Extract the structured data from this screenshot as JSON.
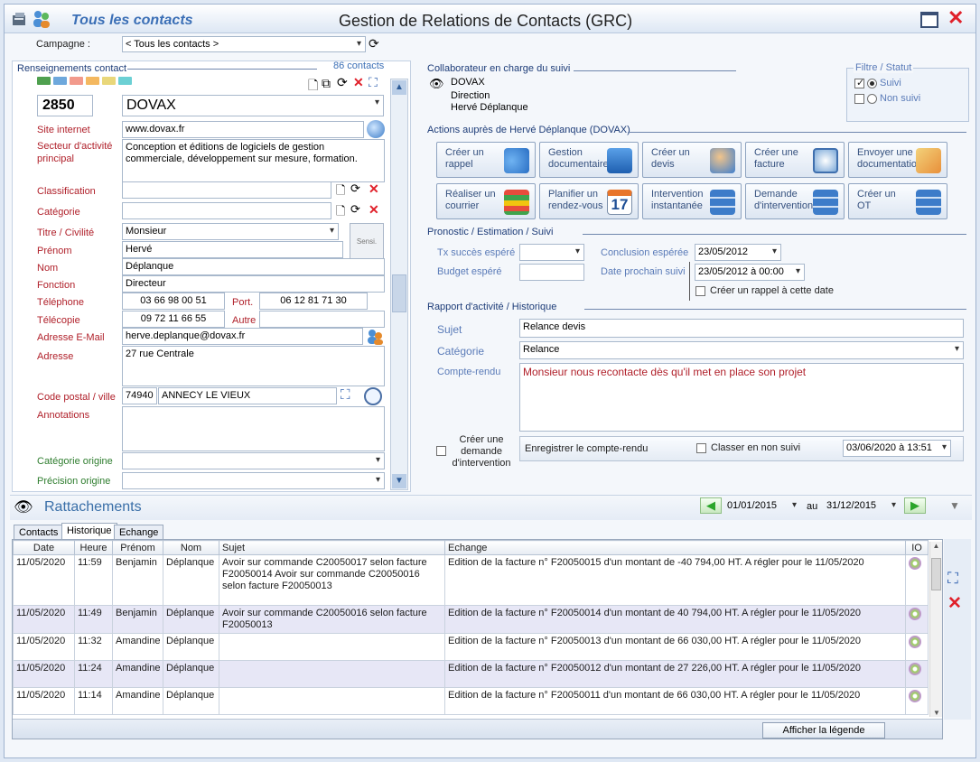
{
  "window": {
    "section_title": "Tous les contacts",
    "app_title": "Gestion de Relations de Contacts (GRC)"
  },
  "campagne": {
    "label": "Campagne :",
    "value": "< Tous les contacts >"
  },
  "contact": {
    "section": "Renseignements contact",
    "count": "86 contacts",
    "code": "2850",
    "name": "DOVAX",
    "site_label": "Site internet",
    "site": "www.dovax.fr",
    "secteur_label": "Secteur d'activité principal",
    "secteur": "Conception et éditions de logiciels de gestion commerciale, développement sur mesure, formation.",
    "classification_label": "Classification",
    "classification": "",
    "categorie_label": "Catégorie",
    "categorie": "",
    "titre_label": "Titre / Civilité",
    "titre": "Monsieur",
    "sensi": "Sensi.",
    "prenom_label": "Prénom",
    "prenom": "Hervé",
    "nom_label": "Nom",
    "nom": "Déplanque",
    "fonction_label": "Fonction",
    "fonction": "Directeur",
    "tel_label": "Téléphone",
    "tel": "03 66 98 00 51",
    "port_label": "Port.",
    "port": "06 12 81 71 30",
    "fax_label": "Télécopie",
    "fax": "09 72 11 66 55",
    "autre_label": "Autre",
    "autre": "",
    "email_label": "Adresse E-Mail",
    "email": "herve.deplanque@dovax.fr",
    "adresse_label": "Adresse",
    "adresse": "27 rue Centrale",
    "cp_label": "Code postal / ville",
    "cp": "74940",
    "ville": "ANNECY LE VIEUX",
    "annotations_label": "Annotations",
    "annotations": "",
    "cat_origine_label": "Catégorie origine",
    "cat_origine": "",
    "precision_label": "Précision origine",
    "precision": ""
  },
  "collaborateur": {
    "section": "Collaborateur en charge du suivi",
    "name": "DOVAX",
    "dept": "Direction",
    "person": "Hervé Déplanque"
  },
  "filtre": {
    "title": "Filtre / Statut",
    "suivi": "Suivi",
    "non_suivi": "Non suivi"
  },
  "actions": {
    "section": "Actions auprès de Hervé Déplanque (DOVAX)",
    "buttons": [
      {
        "l1": "Créer un",
        "l2": "rappel"
      },
      {
        "l1": "Gestion",
        "l2": "documentaire"
      },
      {
        "l1": "Créer un",
        "l2": "devis"
      },
      {
        "l1": "Créer une",
        "l2": "facture"
      },
      {
        "l1": "Envoyer une",
        "l2": "documentation"
      },
      {
        "l1": "Réaliser un",
        "l2": "courrier"
      },
      {
        "l1": "Planifier un",
        "l2": "rendez-vous"
      },
      {
        "l1": "Intervention",
        "l2": "instantanée"
      },
      {
        "l1": "Demande",
        "l2": "d'intervention"
      },
      {
        "l1": "Créer un",
        "l2": "OT"
      }
    ],
    "calendar_day": "17"
  },
  "pronostic": {
    "section": "Pronostic / Estimation / Suivi",
    "tx_label": "Tx succès espéré",
    "tx": "",
    "budget_label": "Budget espéré",
    "budget": "",
    "conclusion_label": "Conclusion espérée",
    "conclusion": "23/05/2012",
    "prochain_label": "Date prochain suivi",
    "prochain": "23/05/2012 à 00:00",
    "rappel_label": "Créer un rappel à cette date"
  },
  "rapport": {
    "section": "Rapport d'activité / Historique",
    "sujet_label": "Sujet",
    "sujet": "Relance devis",
    "categorie_label": "Catégorie",
    "categorie": "Relance",
    "compte_label": "Compte-rendu",
    "compte": "Monsieur nous recontacte dès qu'il met en place son projet",
    "demande_label": "Créer une demande d'intervention",
    "enregistrer": "Enregistrer le compte-rendu",
    "classer": "Classer en non suivi",
    "date": "03/06/2020 à 13:51"
  },
  "rattachements": {
    "title": "Rattachements",
    "from": "01/01/2015",
    "au": "au",
    "to": "31/12/2015",
    "tabs": [
      "Contacts",
      "Historique",
      "Echange"
    ],
    "columns": [
      "Date",
      "Heure",
      "Prénom",
      "Nom",
      "Sujet",
      "Echange",
      "IO"
    ],
    "rows": [
      {
        "date": "11/05/2020",
        "heure": "11:59",
        "prenom": "Benjamin",
        "nom": "Déplanque",
        "sujet": "Avoir sur commande C20050017 selon facture F20050014 Avoir sur commande C20050016 selon facture F20050013",
        "echange": "Edition de la facture n° F20050015 d'un montant de -40 794,00 HT. A régler pour le 11/05/2020"
      },
      {
        "date": "11/05/2020",
        "heure": "11:49",
        "prenom": "Benjamin",
        "nom": "Déplanque",
        "sujet": "Avoir sur commande C20050016 selon facture F20050013",
        "echange": "Edition de la facture n° F20050014 d'un montant de 40 794,00 HT. A régler pour le 11/05/2020"
      },
      {
        "date": "11/05/2020",
        "heure": "11:32",
        "prenom": "Amandine",
        "nom": "Déplanque",
        "sujet": "",
        "echange": "Edition de la facture n° F20050013 d'un montant de 66 030,00 HT. A régler pour le 11/05/2020"
      },
      {
        "date": "11/05/2020",
        "heure": "11:24",
        "prenom": "Amandine",
        "nom": "Déplanque",
        "sujet": "",
        "echange": "Edition de la facture n° F20050012 d'un montant de 27 226,00 HT. A régler pour le 11/05/2020"
      },
      {
        "date": "11/05/2020",
        "heure": "11:14",
        "prenom": "Amandine",
        "nom": "Déplanque",
        "sujet": "",
        "echange": "Edition de la facture n° F20050011 d'un montant de 66 030,00 HT. A régler pour le 11/05/2020"
      }
    ],
    "legend_button": "Afficher la légende"
  }
}
